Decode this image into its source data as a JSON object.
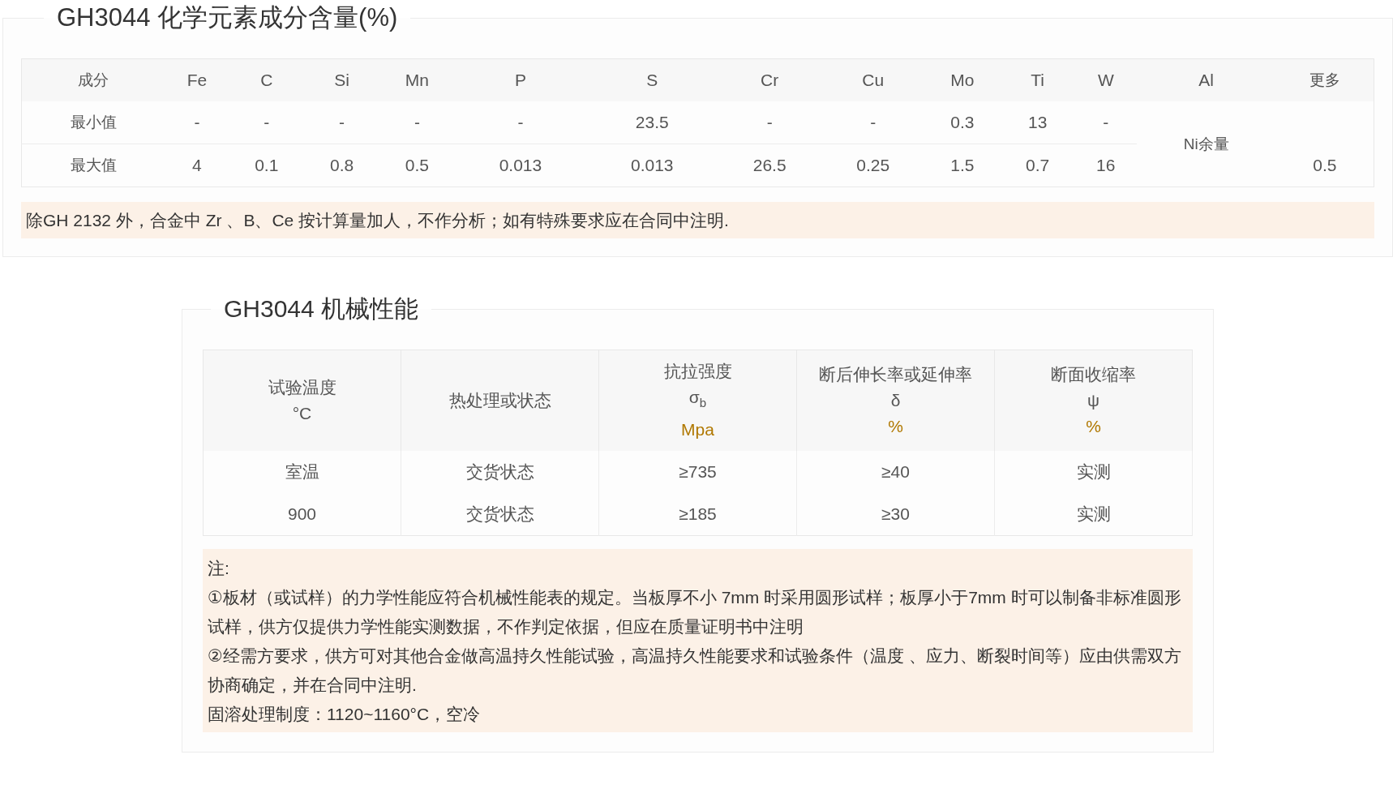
{
  "composition": {
    "title": "GH3044 化学元素成分含量(%)",
    "header": [
      "成分",
      "Fe",
      "C",
      "Si",
      "Mn",
      "P",
      "S",
      "Cr",
      "Cu",
      "Mo",
      "Ti",
      "W",
      "Al",
      "更多"
    ],
    "rows": [
      {
        "label": "最小值",
        "values": [
          "-",
          "-",
          "-",
          "-",
          "-",
          "23.5",
          "-",
          "-",
          "0.3",
          "13",
          "-"
        ]
      },
      {
        "label": "最大值",
        "values": [
          "4",
          "0.1",
          "0.8",
          "0.5",
          "0.013",
          "0.013",
          "26.5",
          "0.25",
          "1.5",
          "0.7",
          "16",
          "0.5"
        ]
      }
    ],
    "more_value": "Ni余量",
    "note": "除GH 2132 外，合金中 Zr 、B、Ce 按计算量加人，不作分析；如有特殊要求应在合同中注明."
  },
  "mechanical": {
    "title": "GH3044 机械性能",
    "columns": [
      {
        "lines": [
          {
            "kind": "name",
            "text": "试验温度"
          },
          {
            "kind": "symbol",
            "text": "°C"
          }
        ]
      },
      {
        "lines": [
          {
            "kind": "name",
            "text": "热处理或状态"
          }
        ]
      },
      {
        "lines": [
          {
            "kind": "name",
            "text": "抗拉强度"
          },
          {
            "kind": "symbol",
            "text": "σ$_{b}$"
          },
          {
            "kind": "unit",
            "text": "Mpa"
          }
        ]
      },
      {
        "lines": [
          {
            "kind": "name",
            "text": "断后伸长率或延伸率"
          },
          {
            "kind": "symbol",
            "text": "δ"
          },
          {
            "kind": "unit",
            "text": "%"
          }
        ]
      },
      {
        "lines": [
          {
            "kind": "name",
            "text": "断面收缩率"
          },
          {
            "kind": "symbol",
            "text": "ψ"
          },
          {
            "kind": "unit",
            "text": "%"
          }
        ]
      }
    ],
    "rows": [
      [
        "室温",
        "交货状态",
        "≥735",
        "≥40",
        "实测"
      ],
      [
        "900",
        "交货状态",
        "≥185",
        "≥30",
        "实测"
      ]
    ],
    "notes": [
      "注:",
      "①板材（或试样）的力学性能应符合机械性能表的规定。当板厚不小 7mm 时采用圆形试样；板厚小于7mm 时可以制备非标准圆形试样，供方仅提供力学性能实测数据，不作判定依据，但应在质量证明书中注明",
      "②经需方要求，供方可对其他合金做高温持久性能试验，高温持久性能要求和试验条件（温度 、应力、断裂时间等）应由供需双方协商确定，并在合同中注明.",
      "固溶处理制度：1120~1160°C，空冷"
    ]
  }
}
